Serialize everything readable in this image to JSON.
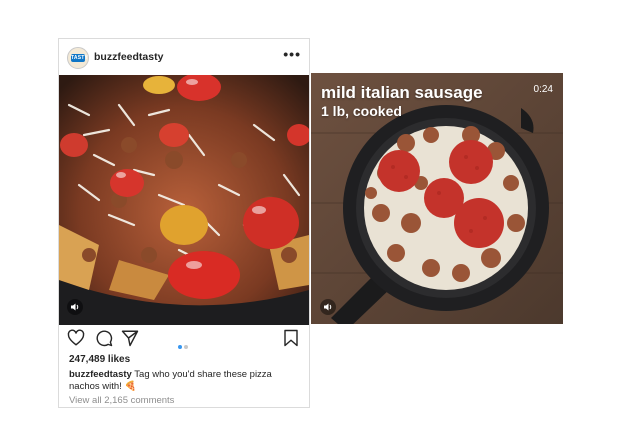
{
  "post": {
    "username": "buzzfeedtasty",
    "avatar_badge": "TASTY",
    "more_label": "•••",
    "likes": "247,489 likes",
    "caption_user": "buzzfeedtasty",
    "caption_text": " Tag who you'd share these pizza nachos with! 🍕",
    "view_comments": "View all 2,165 comments",
    "carousel": {
      "count": 2,
      "active_index": 0,
      "active_color": "#3897f0",
      "inactive_color": "#c7c7c7"
    }
  },
  "video": {
    "title": "mild italian sausage",
    "subtitle": "1 lb, cooked",
    "timestamp": "0:24"
  },
  "icons": {
    "like": "heart-icon",
    "comment": "comment-icon",
    "share": "send-icon",
    "save": "bookmark-icon",
    "sound": "speaker-icon"
  }
}
